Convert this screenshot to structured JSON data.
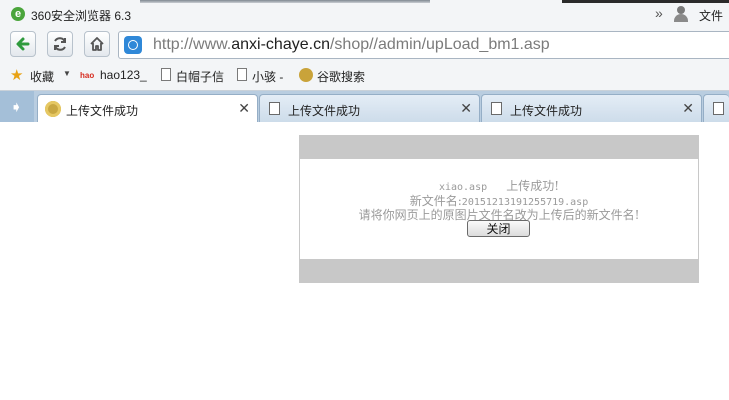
{
  "titlebar": {
    "app_name": "360安全浏览器 6.3",
    "more_glyph": "»",
    "file_menu": "文件"
  },
  "navbar": {
    "url_prefix": "http://www.",
    "url_domain": "anxi-chaye.cn",
    "url_path": "/shop//admin/upLoad_bm1.asp"
  },
  "bookmarks": {
    "favorites_label": "收藏",
    "items": [
      {
        "label": "hao123_",
        "icon": "hao123-icon"
      },
      {
        "label": "白帽子信",
        "icon": "page-icon"
      },
      {
        "label": "小骇 -",
        "icon": "page-icon"
      },
      {
        "label": "谷歌搜索",
        "icon": "google-icon"
      }
    ]
  },
  "tabs": [
    {
      "label": "上传文件成功",
      "active": true,
      "close": "✕"
    },
    {
      "label": "上传文件成功",
      "active": false,
      "close": "✕"
    },
    {
      "label": "上传文件成功",
      "active": false,
      "close": "✕"
    }
  ],
  "dialog": {
    "line1_file": "xiao.asp",
    "line1_status": "上传成功!",
    "line2_label": "新文件名:",
    "line2_value": "20151213191255719.asp",
    "line3": "请将你网页上的原图片文件名改为上传后的新文件名!",
    "close_button": "关闭"
  },
  "colors": {
    "accent": "#2f88d8",
    "dialog_band": "#c8c8c8",
    "tab_strip": "#b9cde0",
    "message_text": "#9a9a9a"
  }
}
